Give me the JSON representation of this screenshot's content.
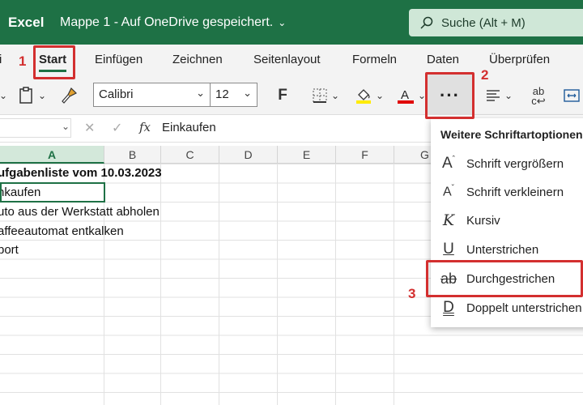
{
  "titlebar": {
    "app_name": "Excel",
    "doc_title": "Mappe 1  -  Auf OneDrive gespeichert.",
    "search_placeholder": "Suche (Alt + M)"
  },
  "tabs": [
    {
      "label": "i"
    },
    {
      "label": "Start"
    },
    {
      "label": "Einfügen"
    },
    {
      "label": "Zeichnen"
    },
    {
      "label": "Seitenlayout"
    },
    {
      "label": "Formeln"
    },
    {
      "label": "Daten"
    },
    {
      "label": "Überprüfen"
    }
  ],
  "toolbar": {
    "font_name": "Calibri",
    "font_size": "12",
    "bold_label": "F",
    "more_label": "···",
    "wrap_label": "ab\nc"
  },
  "formula_bar": {
    "fx_label": "fx",
    "value": "Einkaufen"
  },
  "columns": [
    "A",
    "B",
    "C",
    "D",
    "E",
    "F",
    "G"
  ],
  "cells": [
    {
      "text": "ufgabenliste vom 10.03.2023",
      "bold": true
    },
    {
      "text": "nkaufen",
      "bold": false
    },
    {
      "text": "uto aus der Werkstatt abholen",
      "bold": false
    },
    {
      "text": "affeeautomat entkalken",
      "bold": false
    },
    {
      "text": "port",
      "bold": false
    }
  ],
  "menu": {
    "title": "Weitere Schriftartoptionen",
    "items": [
      {
        "icon": "A˄",
        "label": "Schrift vergrößern",
        "icon_name": "font-grow-icon"
      },
      {
        "icon": "A˅",
        "label": "Schrift verkleinern",
        "icon_name": "font-shrink-icon"
      },
      {
        "icon": "K",
        "label": "Kursiv",
        "icon_name": "italic-icon"
      },
      {
        "icon": "U",
        "label": "Unterstrichen",
        "icon_name": "underline-icon"
      },
      {
        "icon": "ab",
        "label": "Durchgestrichen",
        "icon_name": "strikethrough-icon"
      },
      {
        "icon": "D",
        "label": "Doppelt unterstrichen",
        "icon_name": "double-underline-icon"
      }
    ]
  },
  "annotations": [
    "1",
    "2",
    "3"
  ],
  "colors": {
    "accent": "#1e7145",
    "annotation": "#d32f2f",
    "highlight_yellow": "#ffeb00",
    "font_red": "#e00000"
  }
}
